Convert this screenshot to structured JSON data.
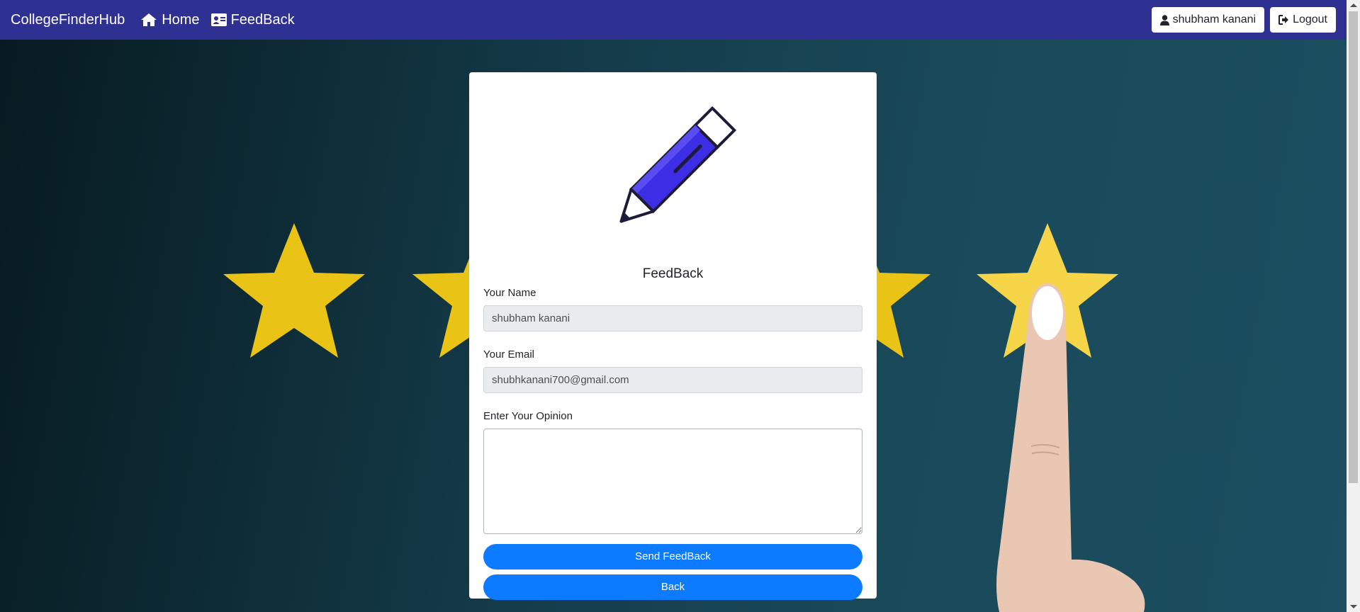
{
  "navbar": {
    "brand": "CollegeFinderHub",
    "home_label": "Home",
    "feedback_label": "FeedBack",
    "user_label": "shubham kanani",
    "logout_label": "Logout",
    "background_color": "#2e3192"
  },
  "form": {
    "title": "FeedBack",
    "name_label": "Your Name",
    "name_value": "shubham kanani",
    "email_label": "Your Email",
    "email_value": "shubhkanani700@gmail.com",
    "opinion_label": "Enter Your Opinion",
    "opinion_value": "",
    "send_button": "Send FeedBack",
    "back_button": "Back",
    "button_color": "#0d7bff"
  },
  "icons": {
    "home": "home-icon",
    "feedback": "id-card-icon",
    "user": "user-icon",
    "logout": "logout-icon",
    "pencil": "pencil-icon"
  }
}
